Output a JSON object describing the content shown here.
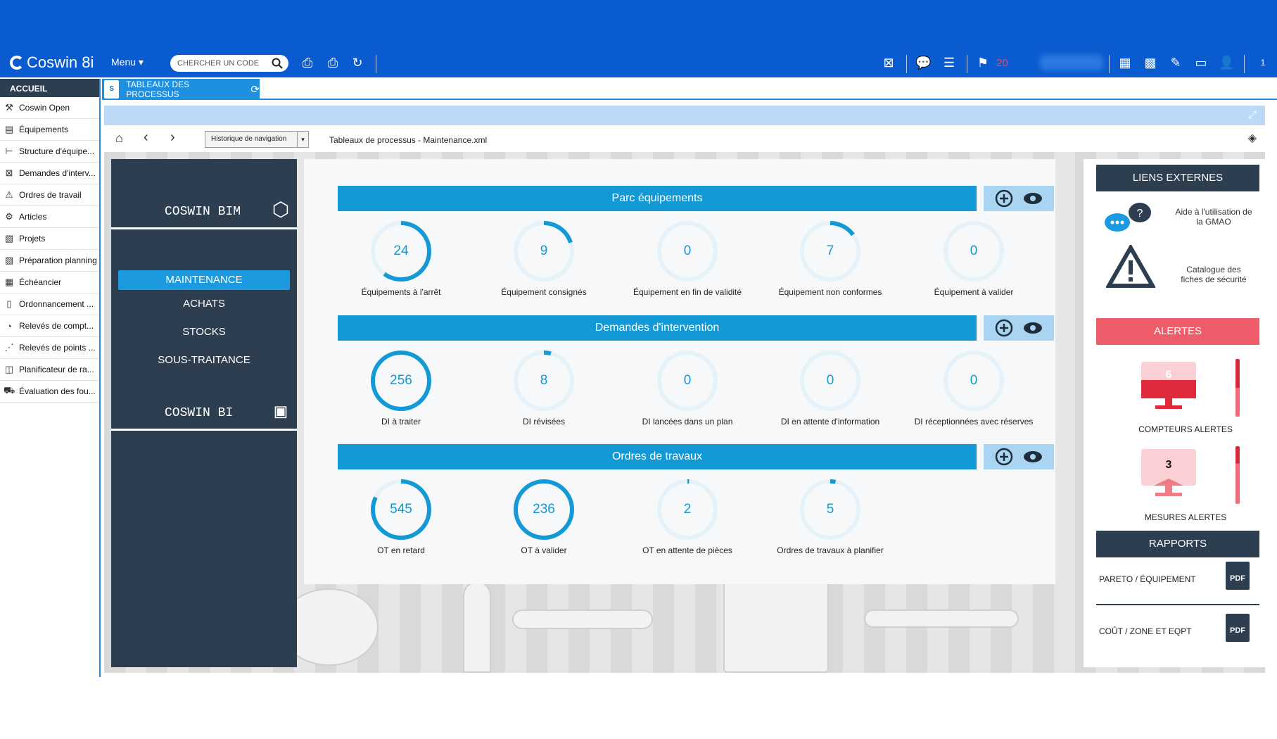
{
  "app": {
    "brand": "Coswin 8i",
    "menu_label": "Menu",
    "search_placeholder": "CHERCHER UN CODE",
    "alert_count": "20",
    "window_index": "1"
  },
  "colors": {
    "topbar": "#0a5bd0",
    "navy": "#2c3e50",
    "accent": "#1299d6",
    "alert": "#ef5d6a"
  },
  "leftnav": {
    "header": "ACCUEIL",
    "items": [
      {
        "label": "Coswin Open",
        "icon": "wrench-icon"
      },
      {
        "label": "Équipements",
        "icon": "equipment-icon"
      },
      {
        "label": "Structure d'équipe...",
        "icon": "tree-icon"
      },
      {
        "label": "Demandes d'interv...",
        "icon": "request-icon"
      },
      {
        "label": "Ordres de travail",
        "icon": "work-order-icon"
      },
      {
        "label": "Articles",
        "icon": "parts-icon"
      },
      {
        "label": "Projets",
        "icon": "project-icon"
      },
      {
        "label": "Préparation planning",
        "icon": "planning-icon"
      },
      {
        "label": "Échéancier",
        "icon": "calendar-icon"
      },
      {
        "label": "Ordonnancement ...",
        "icon": "schedule-icon"
      },
      {
        "label": "Relevés de compt...",
        "icon": "gauge-icon"
      },
      {
        "label": "Relevés de points ...",
        "icon": "points-icon"
      },
      {
        "label": "Planificateur de ra...",
        "icon": "planner-icon"
      },
      {
        "label": "Évaluation des fou...",
        "icon": "supplier-icon"
      }
    ]
  },
  "tab": {
    "label": "TABLEAUX DES PROCESSUS",
    "badge": "S"
  },
  "navbar": {
    "history": "Historique de navigation",
    "path": "Tableaux de processus - Maintenance.xml"
  },
  "side": {
    "bim": "COSWIN BIM",
    "bi": "COSWIN BI",
    "menu": [
      "MAINTENANCE",
      "ACHATS",
      "STOCKS",
      "SOUS-TRAITANCE"
    ]
  },
  "sections": [
    {
      "title": "Parc équipements",
      "kpis": [
        {
          "value": "24",
          "label": "Équipements à l'arrêt",
          "fraction": 0.6
        },
        {
          "value": "9",
          "label": "Équipement consignés",
          "fraction": 0.2
        },
        {
          "value": "0",
          "label": "Équipement en fin de validité",
          "fraction": 0
        },
        {
          "value": "7",
          "label": "Équipement non conformes",
          "fraction": 0.15
        },
        {
          "value": "0",
          "label": "Équipement à valider",
          "fraction": 0
        }
      ]
    },
    {
      "title": "Demandes d'intervention",
      "kpis": [
        {
          "value": "256",
          "label": "DI à traiter",
          "fraction": 1
        },
        {
          "value": "8",
          "label": "DI révisées",
          "fraction": 0.04
        },
        {
          "value": "0",
          "label": "DI lancées dans un plan",
          "fraction": 0
        },
        {
          "value": "0",
          "label": "DI en attente d'information",
          "fraction": 0
        },
        {
          "value": "0",
          "label": "DI réceptionnées avec réserves",
          "fraction": 0
        }
      ]
    },
    {
      "title": "Ordres de travaux",
      "kpis": [
        {
          "value": "545",
          "label": "OT en retard",
          "fraction": 0.82
        },
        {
          "value": "236",
          "label": "OT à valider",
          "fraction": 1
        },
        {
          "value": "2",
          "label": "OT en attente de pièces",
          "fraction": 0.01
        },
        {
          "value": "5",
          "label": "Ordres de travaux à planifier",
          "fraction": 0.03
        }
      ]
    }
  ],
  "right": {
    "links_header": "LIENS EXTERNES",
    "links": [
      "Aide à l'utilisation de la GMAO",
      "Catalogue des fiches de sécurité"
    ],
    "alerts_header": "ALERTES",
    "counters": {
      "value": "6",
      "label": "COMPTEURS ALERTES",
      "level": 0.5
    },
    "measures": {
      "value": "3",
      "label": "MESURES ALERTES",
      "level": 0.3
    },
    "reports_header": "RAPPORTS",
    "reports": [
      "PARETO / ÉQUIPEMENT",
      "COÛT / ZONE ET EQPT"
    ],
    "pdf": "PDF"
  }
}
